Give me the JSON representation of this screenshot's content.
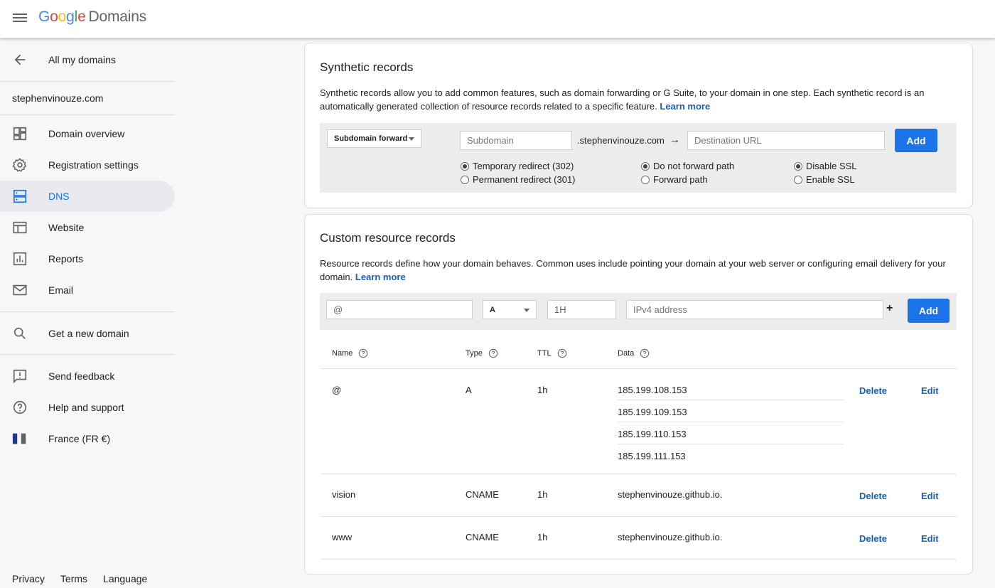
{
  "header": {
    "logo": {
      "g1": "G",
      "g2": "o",
      "g3": "o",
      "g4": "g",
      "g5": "l",
      "g6": "e",
      "product": "Domains"
    }
  },
  "sidebar": {
    "back_label": "All my domains",
    "domain": "stephenvinouze.com",
    "items": [
      {
        "label": "Domain overview",
        "icon": "dashboard-icon"
      },
      {
        "label": "Registration settings",
        "icon": "gear-icon"
      },
      {
        "label": "DNS",
        "icon": "dns-icon",
        "active": true
      },
      {
        "label": "Website",
        "icon": "website-icon"
      },
      {
        "label": "Reports",
        "icon": "reports-icon"
      },
      {
        "label": "Email",
        "icon": "email-icon"
      }
    ],
    "get_domain": "Get a new domain",
    "feedback": "Send feedback",
    "help": "Help and support",
    "locale": "France (FR €)",
    "footer": {
      "privacy": "Privacy",
      "terms": "Terms",
      "language": "Language"
    }
  },
  "synthetic": {
    "title": "Synthetic records",
    "desc": "Synthetic records allow you to add common features, such as domain forwarding or G Suite, to your domain in one step. Each synthetic record is an automatically generated collection of resource records related to a specific feature.",
    "learn_more": "Learn more",
    "type_select": "Subdomain forward",
    "subdomain_placeholder": "Subdomain",
    "domain_suffix": ".stephenvinouze.com",
    "arrow": "→",
    "destination_placeholder": "Destination URL",
    "add": "Add",
    "radios": {
      "temporary": "Temporary redirect (302)",
      "permanent": "Permanent redirect (301)",
      "no_forward_path": "Do not forward path",
      "forward_path": "Forward path",
      "disable_ssl": "Disable SSL",
      "enable_ssl": "Enable SSL"
    }
  },
  "custom": {
    "title": "Custom resource records",
    "desc": "Resource records define how your domain behaves. Common uses include pointing your domain at your web server or configuring email delivery for your domain.",
    "learn_more": "Learn more",
    "name_value": "@",
    "type_value": "A",
    "ttl_value": "1H",
    "data_placeholder": "IPv4 address",
    "plus": "+",
    "add": "Add",
    "columns": {
      "name": "Name",
      "type": "Type",
      "ttl": "TTL",
      "data": "Data"
    },
    "rows": [
      {
        "name": "@",
        "type": "A",
        "ttl": "1h",
        "data": [
          "185.199.108.153",
          "185.199.109.153",
          "185.199.110.153",
          "185.199.111.153"
        ],
        "delete": "Delete",
        "edit": "Edit"
      },
      {
        "name": "vision",
        "type": "CNAME",
        "ttl": "1h",
        "data": [
          "stephenvinouze.github.io."
        ],
        "delete": "Delete",
        "edit": "Edit"
      },
      {
        "name": "www",
        "type": "CNAME",
        "ttl": "1h",
        "data": [
          "stephenvinouze.github.io."
        ],
        "delete": "Delete",
        "edit": "Edit"
      }
    ]
  },
  "colors": {
    "accent": "#1a73e8",
    "link": "#1a5fb4",
    "active_bg": "#e8eaed"
  }
}
